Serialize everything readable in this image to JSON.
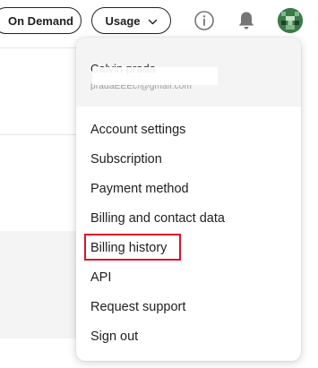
{
  "header": {
    "on_demand_label": "On Demand",
    "usage_label": "Usage"
  },
  "account_menu": {
    "user_name": "Calvin prada",
    "user_email": "pradaEEEcf@gmail.com",
    "items": [
      {
        "label": "Account settings"
      },
      {
        "label": "Subscription"
      },
      {
        "label": "Payment method"
      },
      {
        "label": "Billing and contact data"
      },
      {
        "label": "Billing history",
        "highlighted": true
      },
      {
        "label": "API"
      },
      {
        "label": "Request support"
      },
      {
        "label": "Sign out"
      }
    ]
  },
  "colors": {
    "highlight": "#d6142b",
    "menu_header_bg": "#f4f4f4",
    "icon": "#757575"
  },
  "icons": [
    "chevron-down-icon",
    "info-icon",
    "bell-icon",
    "avatar"
  ]
}
